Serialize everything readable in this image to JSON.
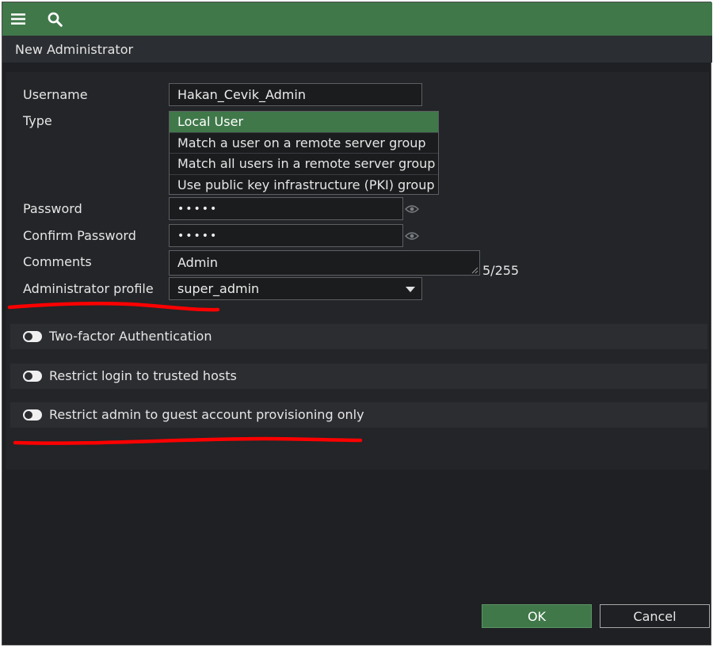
{
  "toolbar": {
    "menu_icon": "hamburger-menu-icon",
    "search_icon": "search-icon",
    "bar_color": "#40784a"
  },
  "dialog": {
    "title": "New Administrator"
  },
  "form": {
    "username_label": "Username",
    "username_value": "Hakan_Cevik_Admin",
    "type_label": "Type",
    "type_options": [
      "Local User",
      "Match a user on a remote server group",
      "Match all users in a remote server group",
      "Use public key infrastructure (PKI) group"
    ],
    "type_selected": "Local User",
    "password_label": "Password",
    "password_value": "•••••",
    "confirm_password_label": "Confirm Password",
    "confirm_password_value": "•••••",
    "comments_label": "Comments",
    "comments_value": "Admin",
    "comments_counter": "5/255",
    "profile_label": "Administrator profile",
    "profile_value": "super_admin"
  },
  "toggles": [
    {
      "label": "Two-factor Authentication",
      "enabled": false
    },
    {
      "label": "Restrict login to trusted hosts",
      "enabled": false
    },
    {
      "label": "Restrict admin to guest account provisioning only",
      "enabled": false
    }
  ],
  "buttons": {
    "ok": "OK",
    "cancel": "Cancel"
  },
  "annotations": {
    "color": "#ff0000"
  }
}
